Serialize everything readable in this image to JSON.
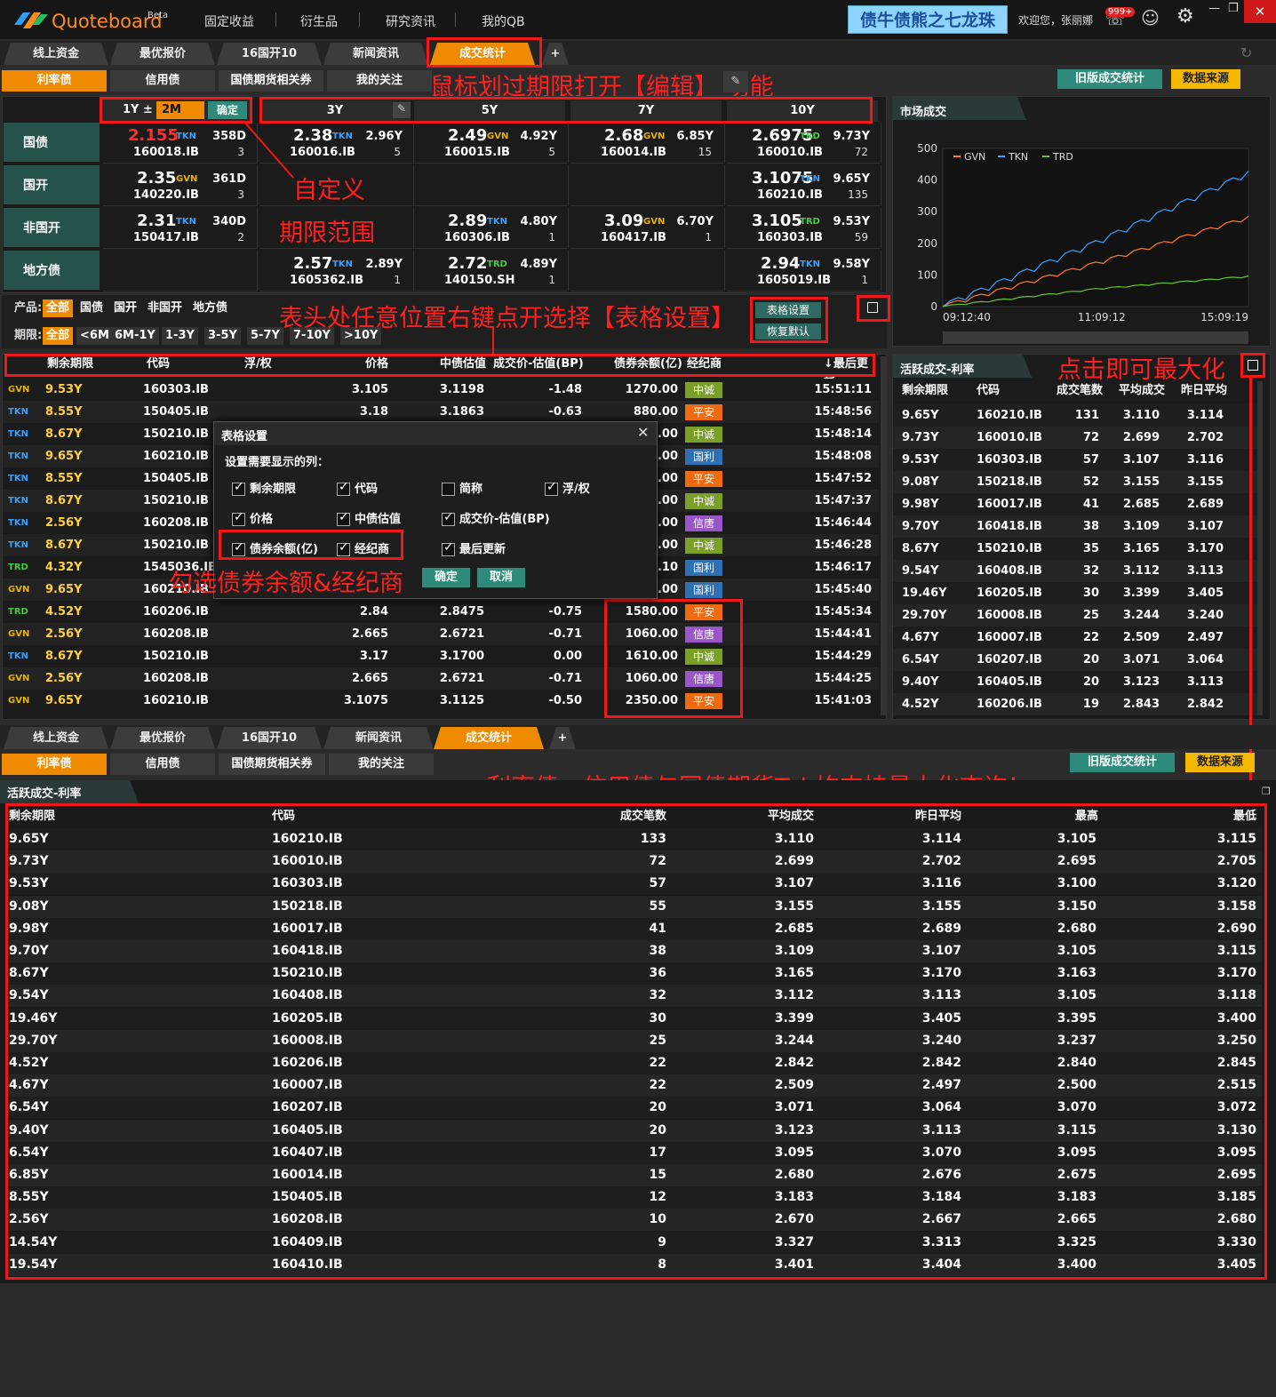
{
  "app": {
    "brand": "Quoteboard",
    "beta": "Beta",
    "nav": [
      "固定收益",
      "衍生品",
      "研究资讯",
      "我的QB"
    ],
    "banner": "债牛债熊之七龙珠",
    "welcome": "欢迎您，张丽娜",
    "badge": "999+"
  },
  "tabs": [
    "线上资金",
    "最优报价",
    "16国开10",
    "新闻资讯",
    "成交统计"
  ],
  "subtabs": [
    "利率债",
    "信用债",
    "国债期货相关券",
    "我的关注"
  ],
  "buttons": {
    "old": "旧版成交统计",
    "source": "数据来源",
    "confirm": "确定",
    "cancel": "取消",
    "table_settings": "表格设置",
    "restore": "恢复默认"
  },
  "annotations": {
    "hover": "鼠标划过期限打开【编辑】  功能",
    "custom": "自定义",
    "range": "期限范围",
    "rightclick": "表头处任意位置右键点开选择【表格设置】",
    "maximize": "点击即可最大化",
    "select": "勾选债券余额&经纪商",
    "maxall": "利率债、信用债与国债期货Tab均支持最大化查询！"
  },
  "matrix": {
    "term_input": {
      "a": "1Y ±",
      "b": "2M",
      "ok": "确定"
    },
    "cols": [
      "3Y",
      "5Y",
      "7Y",
      "10Y"
    ],
    "rows": [
      {
        "name": "国债",
        "cells": [
          {
            "px": "2.155",
            "src": "TKN",
            "term": "358D",
            "code": "160018.IB",
            "cnt": "3",
            "red": true
          },
          {
            "px": "2.38",
            "src": "TKN",
            "term": "2.96Y",
            "code": "160016.IB",
            "cnt": "5"
          },
          {
            "px": "2.49",
            "src": "GVN",
            "term": "4.92Y",
            "code": "160015.IB",
            "cnt": "5"
          },
          {
            "px": "2.68",
            "src": "GVN",
            "term": "6.85Y",
            "code": "160014.IB",
            "cnt": "15"
          },
          {
            "px": "2.6975",
            "src": "TRD",
            "term": "9.73Y",
            "code": "160010.IB",
            "cnt": "72"
          }
        ]
      },
      {
        "name": "国开",
        "cells": [
          {
            "px": "2.35",
            "src": "GVN",
            "term": "361D",
            "code": "140220.IB",
            "cnt": "3"
          },
          null,
          null,
          null,
          {
            "px": "3.1075",
            "src": "TKN",
            "term": "9.65Y",
            "code": "160210.IB",
            "cnt": "135"
          }
        ]
      },
      {
        "name": "非国开",
        "cells": [
          {
            "px": "2.31",
            "src": "TKN",
            "term": "340D",
            "code": "150417.IB",
            "cnt": "2"
          },
          null,
          {
            "px": "2.89",
            "src": "TKN",
            "term": "4.80Y",
            "code": "160306.IB",
            "cnt": "1"
          },
          {
            "px": "3.09",
            "src": "GVN",
            "term": "6.70Y",
            "code": "160417.IB",
            "cnt": "1"
          },
          {
            "px": "3.105",
            "src": "TRD",
            "term": "9.53Y",
            "code": "160303.IB",
            "cnt": "59"
          }
        ]
      },
      {
        "name": "地方债",
        "cells": [
          null,
          {
            "px": "2.57",
            "src": "TKN",
            "term": "2.89Y",
            "code": "1605362.IB",
            "cnt": "1"
          },
          {
            "px": "2.72",
            "src": "TRD",
            "term": "4.89Y",
            "code": "140150.SH",
            "cnt": "1"
          },
          null,
          {
            "px": "2.94",
            "src": "TKN",
            "term": "9.58Y",
            "code": "1605019.IB",
            "cnt": "1"
          }
        ]
      }
    ]
  },
  "filters": {
    "product_label": "产品:",
    "products": [
      "全部",
      "国债",
      "国开",
      "非国开",
      "地方债"
    ],
    "term_label": "期限:",
    "terms": [
      "全部",
      "<6M",
      "6M-1Y",
      "1-3Y",
      "3-5Y",
      "5-7Y",
      "7-10Y",
      ">10Y"
    ]
  },
  "trades": {
    "headers": [
      "剩余期限",
      "代码",
      "浮/权",
      "价格",
      "中债估值",
      "成交价-估值(BP)",
      "债券余额(亿)",
      "经纪商",
      "↓最后更新"
    ],
    "rows": [
      [
        "GVN",
        "9.53Y",
        "160303.IB",
        "",
        "3.105",
        "3.1198",
        "-1.48",
        "1270.00",
        "中诚",
        "15:51:11"
      ],
      [
        "TKN",
        "8.55Y",
        "150405.IB",
        "",
        "3.18",
        "3.1863",
        "-0.63",
        "880.00",
        "平安",
        "15:48:56"
      ],
      [
        "TKN",
        "8.67Y",
        "150210.IB",
        "",
        "",
        "",
        "",
        ".00",
        "中诚",
        "15:48:14"
      ],
      [
        "TKN",
        "9.65Y",
        "160210.IB",
        "",
        "",
        "",
        "",
        ".00",
        "国利",
        "15:48:08"
      ],
      [
        "TKN",
        "8.55Y",
        "150405.IB",
        "",
        "",
        "",
        "",
        ".00",
        "平安",
        "15:47:52"
      ],
      [
        "TKN",
        "8.67Y",
        "150210.IB",
        "",
        "",
        "",
        "",
        ".00",
        "中诚",
        "15:47:37"
      ],
      [
        "TKN",
        "2.56Y",
        "160208.IB",
        "",
        "",
        "",
        "",
        ".00",
        "信唐",
        "15:46:44"
      ],
      [
        "TKN",
        "8.67Y",
        "150210.IB",
        "",
        "",
        "",
        "",
        ".00",
        "中诚",
        "15:46:28"
      ],
      [
        "TRD",
        "4.32Y",
        "1545036.IB",
        "",
        "",
        "",
        "",
        ".10",
        "国利",
        "15:46:17"
      ],
      [
        "GVN",
        "9.65Y",
        "160210.IB",
        "",
        "",
        "",
        "",
        ".00",
        "国利",
        "15:45:40"
      ],
      [
        "TRD",
        "4.52Y",
        "160206.IB",
        "",
        "2.84",
        "2.8475",
        "-0.75",
        "1580.00",
        "平安",
        "15:45:34"
      ],
      [
        "GVN",
        "2.56Y",
        "160208.IB",
        "",
        "2.665",
        "2.6721",
        "-0.71",
        "1060.00",
        "信唐",
        "15:44:41"
      ],
      [
        "TKN",
        "8.67Y",
        "150210.IB",
        "",
        "3.17",
        "3.1700",
        "0.00",
        "1610.00",
        "中诚",
        "15:44:29"
      ],
      [
        "GVN",
        "2.56Y",
        "160208.IB",
        "",
        "2.665",
        "2.6721",
        "-0.71",
        "1060.00",
        "信唐",
        "15:44:25"
      ],
      [
        "GVN",
        "9.65Y",
        "160210.IB",
        "",
        "3.1075",
        "3.1125",
        "-0.50",
        "2350.00",
        "平安",
        "15:41:03"
      ]
    ]
  },
  "dialog": {
    "title": "表格设置",
    "subtitle": "设置需要显示的列：",
    "options": [
      {
        "label": "剩余期限",
        "on": true
      },
      {
        "label": "代码",
        "on": true
      },
      {
        "label": "简称",
        "on": false
      },
      {
        "label": "浮/权",
        "on": true
      },
      {
        "label": "价格",
        "on": true
      },
      {
        "label": "中债估值",
        "on": true
      },
      {
        "label": "成交价-估值(BP)",
        "on": true
      },
      {
        "label": "债券余额(亿)",
        "on": true
      },
      {
        "label": "经纪商",
        "on": true
      },
      {
        "label": "最后更新",
        "on": true
      }
    ]
  },
  "market": {
    "title": "市场成交",
    "legend": [
      "GVN",
      "TKN",
      "TRD"
    ],
    "colors": {
      "GVN": "#ff7a2a",
      "TKN": "#3aa0ff",
      "TRD": "#6ac23a"
    },
    "chart_data": {
      "type": "line",
      "x": [
        "09:12:40",
        "11:09:12",
        "15:09:19"
      ],
      "ylim": [
        0,
        500
      ],
      "yticks": [
        0,
        100,
        200,
        300,
        400,
        500
      ],
      "series": [
        {
          "name": "GVN",
          "values": [
            0,
            135,
            280
          ]
        },
        {
          "name": "TKN",
          "values": [
            0,
            200,
            420
          ]
        },
        {
          "name": "TRD",
          "values": [
            0,
            55,
            95
          ]
        }
      ]
    }
  },
  "active": {
    "title": "活跃成交-利率",
    "headers": [
      "剩余期限",
      "代码",
      "成交笔数",
      "平均成交",
      "昨日平均"
    ],
    "rows": [
      [
        "9.65Y",
        "160210.IB",
        "131",
        "3.110",
        "3.114"
      ],
      [
        "9.73Y",
        "160010.IB",
        "72",
        "2.699",
        "2.702"
      ],
      [
        "9.53Y",
        "160303.IB",
        "57",
        "3.107",
        "3.116"
      ],
      [
        "9.08Y",
        "150218.IB",
        "52",
        "3.155",
        "3.155"
      ],
      [
        "9.98Y",
        "160017.IB",
        "41",
        "2.685",
        "2.689"
      ],
      [
        "9.70Y",
        "160418.IB",
        "38",
        "3.109",
        "3.107"
      ],
      [
        "8.67Y",
        "150210.IB",
        "35",
        "3.165",
        "3.170"
      ],
      [
        "9.54Y",
        "160408.IB",
        "32",
        "3.112",
        "3.113"
      ],
      [
        "19.46Y",
        "160205.IB",
        "30",
        "3.399",
        "3.405"
      ],
      [
        "29.70Y",
        "160008.IB",
        "25",
        "3.244",
        "3.240"
      ],
      [
        "4.67Y",
        "160007.IB",
        "22",
        "2.509",
        "2.497"
      ],
      [
        "6.54Y",
        "160207.IB",
        "20",
        "3.071",
        "3.064"
      ],
      [
        "9.40Y",
        "160405.IB",
        "20",
        "3.123",
        "3.113"
      ],
      [
        "4.52Y",
        "160206.IB",
        "19",
        "2.843",
        "2.842"
      ]
    ]
  },
  "big": {
    "title": "活跃成交-利率",
    "headers": [
      "剩余期限",
      "代码",
      "成交笔数",
      "平均成交",
      "昨日平均",
      "最高",
      "最低"
    ],
    "rows": [
      [
        "9.65Y",
        "160210.IB",
        "133",
        "3.110",
        "3.114",
        "3.105",
        "3.115"
      ],
      [
        "9.73Y",
        "160010.IB",
        "72",
        "2.699",
        "2.702",
        "2.695",
        "2.705"
      ],
      [
        "9.53Y",
        "160303.IB",
        "57",
        "3.107",
        "3.116",
        "3.100",
        "3.120"
      ],
      [
        "9.08Y",
        "150218.IB",
        "55",
        "3.155",
        "3.155",
        "3.150",
        "3.158"
      ],
      [
        "9.98Y",
        "160017.IB",
        "41",
        "2.685",
        "2.689",
        "2.680",
        "2.690"
      ],
      [
        "9.70Y",
        "160418.IB",
        "38",
        "3.109",
        "3.107",
        "3.105",
        "3.115"
      ],
      [
        "8.67Y",
        "150210.IB",
        "36",
        "3.165",
        "3.170",
        "3.163",
        "3.170"
      ],
      [
        "9.54Y",
        "160408.IB",
        "32",
        "3.112",
        "3.113",
        "3.105",
        "3.118"
      ],
      [
        "19.46Y",
        "160205.IB",
        "30",
        "3.399",
        "3.405",
        "3.395",
        "3.400"
      ],
      [
        "29.70Y",
        "160008.IB",
        "25",
        "3.244",
        "3.240",
        "3.237",
        "3.250"
      ],
      [
        "4.52Y",
        "160206.IB",
        "22",
        "2.842",
        "2.842",
        "2.840",
        "2.845"
      ],
      [
        "4.67Y",
        "160007.IB",
        "22",
        "2.509",
        "2.497",
        "2.500",
        "2.515"
      ],
      [
        "6.54Y",
        "160207.IB",
        "20",
        "3.071",
        "3.064",
        "3.070",
        "3.072"
      ],
      [
        "9.40Y",
        "160405.IB",
        "20",
        "3.123",
        "3.113",
        "3.115",
        "3.130"
      ],
      [
        "6.54Y",
        "160407.IB",
        "17",
        "3.095",
        "3.070",
        "3.095",
        "3.095"
      ],
      [
        "6.85Y",
        "160014.IB",
        "15",
        "2.680",
        "2.676",
        "2.675",
        "2.695"
      ],
      [
        "8.55Y",
        "150405.IB",
        "12",
        "3.183",
        "3.184",
        "3.183",
        "3.185"
      ],
      [
        "2.56Y",
        "160208.IB",
        "10",
        "2.670",
        "2.667",
        "2.665",
        "2.680"
      ],
      [
        "14.54Y",
        "160409.IB",
        "9",
        "3.327",
        "3.313",
        "3.325",
        "3.330"
      ],
      [
        "19.54Y",
        "160410.IB",
        "8",
        "3.401",
        "3.404",
        "3.400",
        "3.405"
      ]
    ]
  }
}
